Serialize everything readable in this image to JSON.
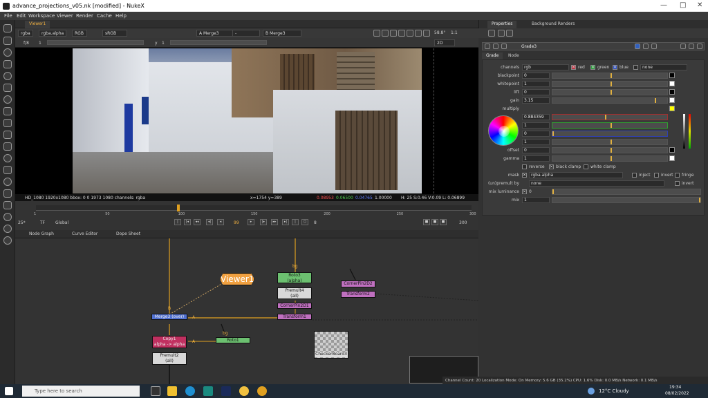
{
  "window": {
    "title": "advance_projections_v05.nk [modified] - NukeX",
    "min": "—",
    "max": "□",
    "close": "✕"
  },
  "menu": [
    "File",
    "Edit",
    "Workspace",
    "Viewer",
    "Render",
    "Cache",
    "Help"
  ],
  "viewer": {
    "tab": "Viewer1",
    "channels": "rgba",
    "alpha": "rgba.alpha",
    "colorspace": "RGB",
    "lut": "sRGB",
    "a_input": "A  Merge3",
    "a_op": "-",
    "b_input": "B  Merge3",
    "zoom": "58.8°",
    "ratio": "1:1",
    "fstop": "f/8",
    "frame_step": "1",
    "y_label": "y",
    "y_value": "1",
    "view": "2D",
    "info_left": "HD_1080 1920x1080  bbox: 0 0 1973 1080 channels: rgba",
    "info_coords": "x=1754 y=389",
    "info_r": "0.08953",
    "info_g": "0.06500",
    "info_b": "0.04765",
    "info_a": "1.00000",
    "info_hsv": "H: 25 S:0.46 V:0.09  L: 0.06899"
  },
  "timeline": {
    "ticks": [
      "1",
      "50",
      "100",
      "150",
      "200",
      "250",
      "300"
    ],
    "playhead_frame": 99,
    "first": "1",
    "last": "300",
    "fps": "25*",
    "tf": "TF",
    "global": "Global",
    "current": "99",
    "step": "8",
    "end": "300"
  },
  "nodegraph": {
    "tabs": [
      "Node Graph",
      "Curve Editor",
      "Dope Sheet"
    ],
    "nodes": {
      "viewer": "Viewer1",
      "roto3": "Roto3",
      "roto3_sub": "(alpha)",
      "premult4": "Premult4",
      "premult4_sub": "(all)",
      "cornerpin2d1": "CornerPin2D1",
      "transform1": "Transform1",
      "cornerpin2d2": "CornerPin2D2",
      "transform2": "Transform2",
      "merge3": "Merge3 (over)",
      "copy1": "Copy1",
      "copy1_sub": "alpha -> alpha",
      "roto1": "Roto1",
      "premult2": "Premult2",
      "premult2_sub": "(all)",
      "checkerboard": "CheckerBoard3",
      "input_b": "B",
      "input_a": "A",
      "input_a2": "A",
      "bg": "bg",
      "bg2": "bg"
    }
  },
  "properties": {
    "tabs": [
      "Properties",
      "Background Renders"
    ],
    "node_name": "Grade3",
    "subtabs": [
      "Grade",
      "Node"
    ],
    "channels_label": "channels",
    "channels": "rgb",
    "red": "red",
    "green": "green",
    "blue": "blue",
    "channel_extra": "none",
    "knobs": [
      {
        "label": "blackpoint",
        "value": "0"
      },
      {
        "label": "whitepoint",
        "value": "1"
      },
      {
        "label": "lift",
        "value": "0"
      },
      {
        "label": "gain",
        "value": "3.15"
      }
    ],
    "multiply_label": "multiply",
    "multiply": [
      "0.884359",
      "1",
      "0",
      "1"
    ],
    "offset": {
      "label": "offset",
      "value": "0"
    },
    "gamma": {
      "label": "gamma",
      "value": "1"
    },
    "reverse": "reverse",
    "black_clamp": "black clamp",
    "white_clamp": "white clamp",
    "mask_label": "mask",
    "mask": "rgba.alpha",
    "inject": "inject",
    "invert": "invert",
    "fringe": "fringe",
    "unpremult_label": "(un)premult by",
    "unpremult": "none",
    "invert2": "invert",
    "mix_lum_label": "mix luminance",
    "mix_lum": "0",
    "mix_label": "mix",
    "mix": "1"
  },
  "status": "Channel Count: 20  Localization Mode: On  Memory: 5.6 GB (35.2%)  CPU: 1.6%  Disk: 0.0 MB/s  Network: 0.1 MB/s",
  "taskbar": {
    "search": "Type here to search",
    "weather": "12°C  Cloudy",
    "time": "19:34",
    "date": "08/02/2022"
  }
}
